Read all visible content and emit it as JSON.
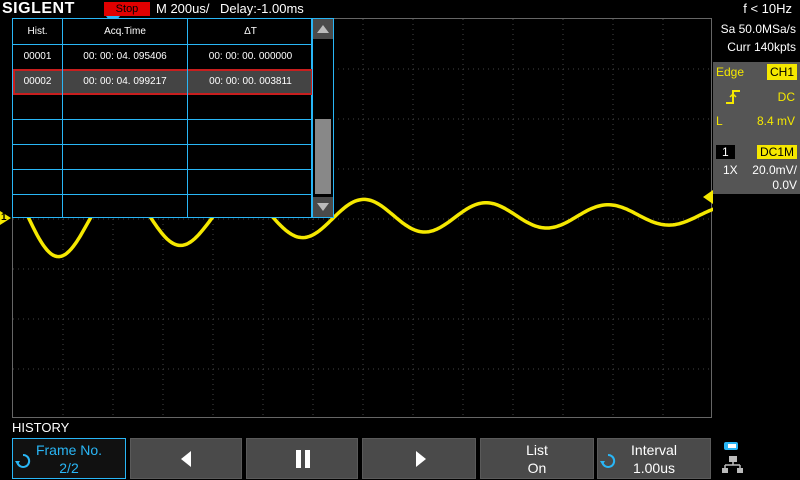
{
  "header": {
    "logo": "SIGLENT",
    "run_state": "Stop",
    "timebase": "M 200us/",
    "delay": "Delay:-1.00ms",
    "trigger_freq": "f < 10Hz"
  },
  "acquisition": {
    "sample_rate": "Sa 50.0MSa/s",
    "memory_depth": "Curr 140kpts"
  },
  "trigger": {
    "type": "Edge",
    "source": "CH1",
    "coupling": "DC",
    "level_label": "L",
    "level": "8.4 mV",
    "slope_icon": "rising-edge-icon"
  },
  "channel1": {
    "number": "1",
    "coupling": "DC1M",
    "probe": "1X",
    "scale": "20.0mV/",
    "offset": "0.0V",
    "marker": "1",
    "color": "#f5e800"
  },
  "history_table": {
    "headers": [
      "Hist.",
      "Acq.Time",
      "ΔT"
    ],
    "rows": [
      [
        "00001",
        "00: 00: 04. 095406",
        "00: 00: 00. 000000"
      ],
      [
        "00002",
        "00: 00: 04. 099217",
        "00: 00: 00. 003811"
      ]
    ],
    "selected_row": 1
  },
  "menu": {
    "title": "HISTORY",
    "softkeys": [
      {
        "label": "Frame No.",
        "value": "2/2"
      },
      {
        "icon": "previous-frame-icon"
      },
      {
        "icon": "pause-icon"
      },
      {
        "icon": "next-frame-icon"
      },
      {
        "label": "List",
        "value": "On"
      },
      {
        "label": "Interval",
        "value": "1.00us"
      }
    ]
  },
  "colors": {
    "accent": "#29b6f6",
    "stop": "#e00000",
    "trace": "#f5e800"
  }
}
